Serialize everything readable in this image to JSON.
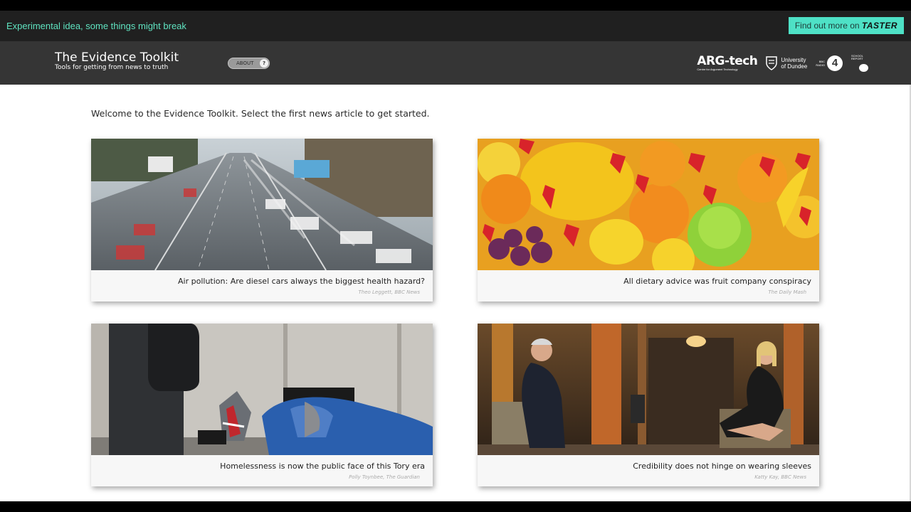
{
  "banner": {
    "experimental_text": "Experimental idea, some things might break",
    "taster_prefix": "Find out more on ",
    "taster_brand": "TASTER"
  },
  "header": {
    "title": "The Evidence Toolkit",
    "subtitle": "Tools for getting from news to truth",
    "about_label": "ABOUT",
    "about_icon": "?",
    "logos": {
      "argtech_name": "ARG-tech",
      "argtech_tagline": "Centre for Argument Technology",
      "dundee_line1": "University",
      "dundee_line2": "of Dundee",
      "radio_bbc": "BBC",
      "radio_word": "RADIO",
      "radio_number": "4",
      "school_line1": "SCHOOL",
      "school_line2": "REPORT"
    }
  },
  "main": {
    "welcome": "Welcome to the Evidence Toolkit. Select the first news article to get started.",
    "articles": [
      {
        "headline": "Air pollution: Are diesel cars always the biggest health hazard?",
        "byline": "Theo Leggett, BBC News",
        "image": "motorway-traffic-photo"
      },
      {
        "headline": "All dietary advice was fruit company conspiracy",
        "byline": "The Daily Mash",
        "image": "fruit-pile-photo"
      },
      {
        "headline": "Homelessness is now the public face of this Tory era",
        "byline": "Polly Toynbee, The Guardian",
        "image": "rough-sleeper-photo"
      },
      {
        "headline": "Credibility does not hinge on wearing sleeves",
        "byline": "Katty Kay, BBC News",
        "image": "interview-photo"
      }
    ]
  },
  "colors": {
    "accent": "#4ee1c6",
    "experimental_text": "#5fe3c0",
    "header_bg": "#353535",
    "topbar_bg": "#202020"
  }
}
